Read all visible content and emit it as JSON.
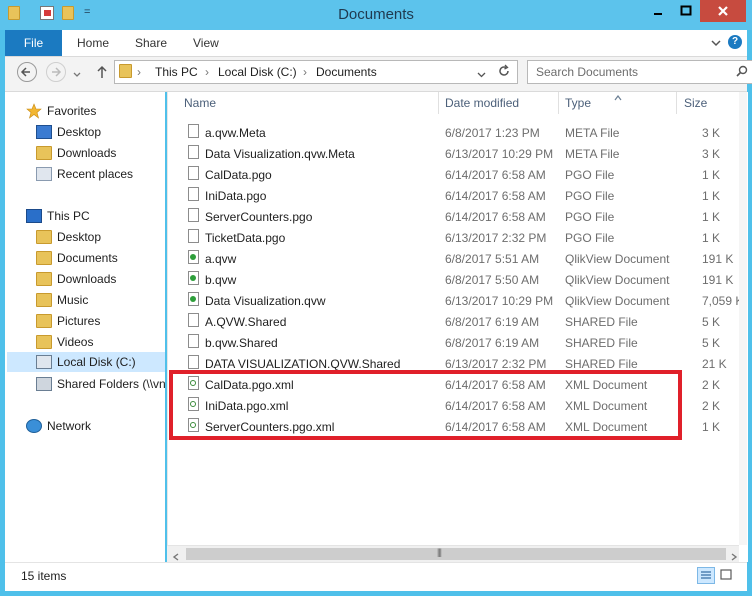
{
  "window": {
    "title": "Documents"
  },
  "quick_access": {
    "dropdown_label": "="
  },
  "ribbon": {
    "file": "File",
    "home": "Home",
    "share": "Share",
    "view": "View",
    "help": "?"
  },
  "address": {
    "crumbs": [
      "This PC",
      "Local Disk (C:)",
      "Documents"
    ],
    "separator": "›",
    "search_placeholder": "Search Documents"
  },
  "nav": {
    "favorites": "Favorites",
    "fav_items": [
      "Desktop",
      "Downloads",
      "Recent places"
    ],
    "this_pc": "This PC",
    "pc_items": [
      "Desktop",
      "Documents",
      "Downloads",
      "Music",
      "Pictures",
      "Videos",
      "Local Disk (C:)",
      "Shared Folders (\\\\vn"
    ],
    "network": "Network"
  },
  "columns": {
    "name": "Name",
    "date": "Date modified",
    "type": "Type",
    "size": "Size"
  },
  "files": [
    {
      "name": "a.qvw.Meta",
      "date": "6/8/2017 1:23 PM",
      "type": "META File",
      "size": "3 K"
    },
    {
      "name": "Data Visualization.qvw.Meta",
      "date": "6/13/2017 10:29 PM",
      "type": "META File",
      "size": "3 K"
    },
    {
      "name": "CalData.pgo",
      "date": "6/14/2017 6:58 AM",
      "type": "PGO File",
      "size": "1 K"
    },
    {
      "name": "IniData.pgo",
      "date": "6/14/2017 6:58 AM",
      "type": "PGO File",
      "size": "1 K"
    },
    {
      "name": "ServerCounters.pgo",
      "date": "6/14/2017 6:58 AM",
      "type": "PGO File",
      "size": "1 K"
    },
    {
      "name": "TicketData.pgo",
      "date": "6/13/2017 2:32 PM",
      "type": "PGO File",
      "size": "1 K"
    },
    {
      "name": "a.qvw",
      "date": "6/8/2017 5:51 AM",
      "type": "QlikView Document",
      "size": "191 K"
    },
    {
      "name": "b.qvw",
      "date": "6/8/2017 5:50 AM",
      "type": "QlikView Document",
      "size": "191 K"
    },
    {
      "name": "Data Visualization.qvw",
      "date": "6/13/2017 10:29 PM",
      "type": "QlikView Document",
      "size": "7,059 K"
    },
    {
      "name": "A.QVW.Shared",
      "date": "6/8/2017 6:19 AM",
      "type": "SHARED File",
      "size": "5 K"
    },
    {
      "name": "b.qvw.Shared",
      "date": "6/8/2017 6:19 AM",
      "type": "SHARED File",
      "size": "5 K"
    },
    {
      "name": "DATA VISUALIZATION.QVW.Shared",
      "date": "6/13/2017 2:32 PM",
      "type": "SHARED File",
      "size": "21 K"
    },
    {
      "name": "CalData.pgo.xml",
      "date": "6/14/2017 6:58 AM",
      "type": "XML Document",
      "size": "2 K"
    },
    {
      "name": "IniData.pgo.xml",
      "date": "6/14/2017 6:58 AM",
      "type": "XML Document",
      "size": "2 K"
    },
    {
      "name": "ServerCounters.pgo.xml",
      "date": "6/14/2017 6:58 AM",
      "type": "XML Document",
      "size": "1 K"
    }
  ],
  "hscroll_grip": "|||",
  "status": {
    "count": "15 items"
  },
  "colors": {
    "title_bar": "#5cc3ec",
    "file_tab": "#1b7ac1",
    "highlight": "#e0202a",
    "close_button": "#c74b3f"
  }
}
